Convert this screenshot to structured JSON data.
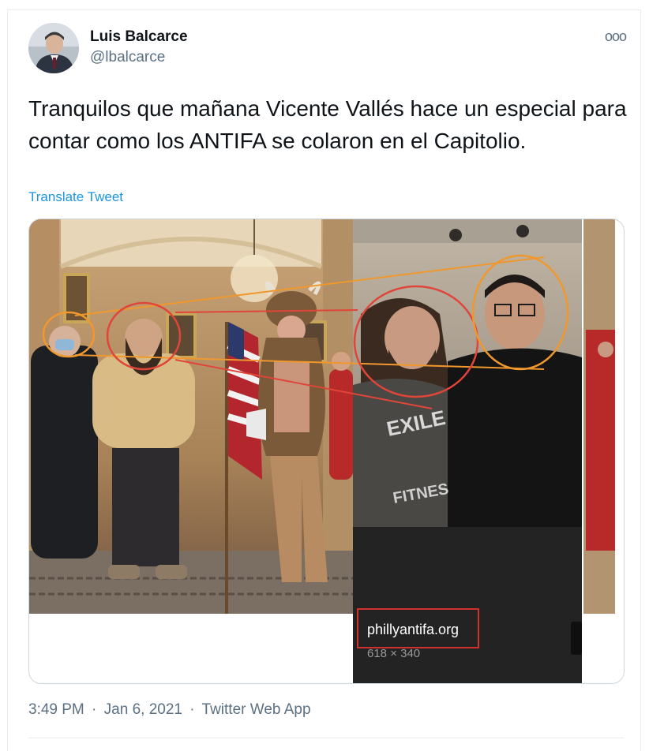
{
  "tweet": {
    "author_name": "Luis Balcarce",
    "author_handle": "@lbalcarce",
    "more_label": "ooo",
    "text": "Tranquilos que mañana Vicente Vallés hace un especial para contar como los ANTIFA se colaron en el Capitolio.",
    "translate_label": "Translate Tweet",
    "time": "3:49 PM",
    "date": "Jan 6, 2021",
    "source": "Twitter Web App",
    "separator": "·"
  },
  "media": {
    "overlay_site": "phillyantifa.org",
    "overlay_dimensions": "618 × 340",
    "shirt_text": "EXILE",
    "shirt_text2": "FITNES"
  },
  "colors": {
    "link": "#1b95e0",
    "secondary_text": "#5b7083",
    "annotation_red": "#e0453a",
    "annotation_orange": "#f0982e"
  }
}
